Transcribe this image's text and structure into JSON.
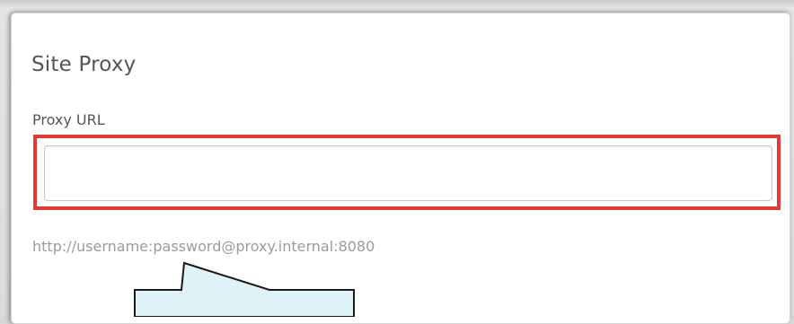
{
  "section": {
    "title": "Site Proxy",
    "field_label": "Proxy URL",
    "input_value": "",
    "hint": "http://username:password@proxy.internal:8080"
  },
  "colors": {
    "highlight": "#e43a32",
    "callout_fill": "#dff2f5"
  }
}
